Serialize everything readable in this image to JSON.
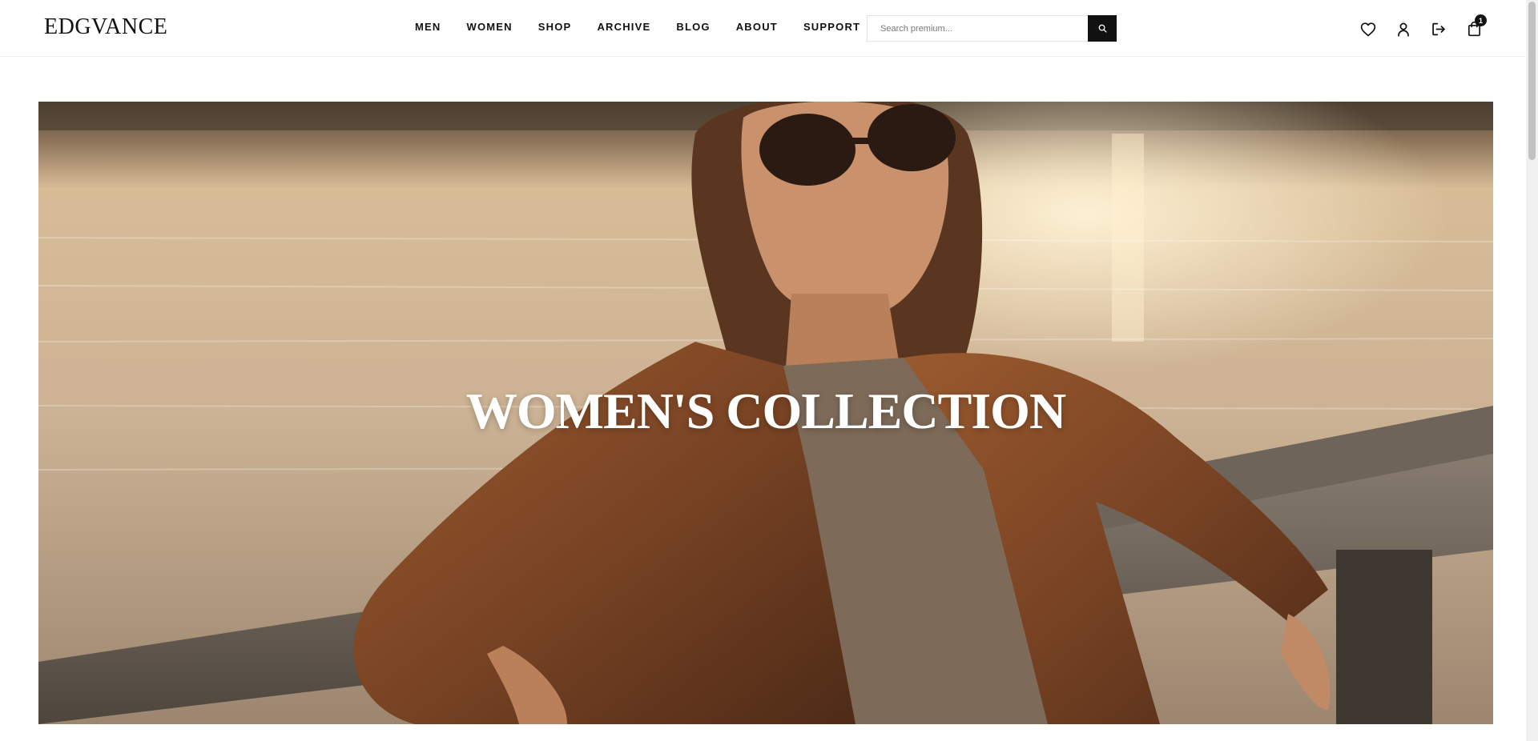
{
  "brand": {
    "logo": "EDGVANCE"
  },
  "nav": {
    "items": [
      {
        "label": "MEN"
      },
      {
        "label": "WOMEN"
      },
      {
        "label": "SHOP"
      },
      {
        "label": "ARCHIVE"
      },
      {
        "label": "BLOG"
      },
      {
        "label": "ABOUT"
      },
      {
        "label": "SUPPORT"
      }
    ]
  },
  "search": {
    "placeholder": "Search premium..."
  },
  "header_icons": {
    "wishlist": "heart-icon",
    "account": "user-icon",
    "logout": "logout-icon",
    "cart": "shopping-bag-icon",
    "cart_count": "1"
  },
  "hero": {
    "title": "WOMEN'S COLLECTION",
    "image": "woman in sunglasses and brown leather jacket on wooden bench by lake at sunset"
  },
  "colors": {
    "primary": "#111111",
    "background": "#ffffff",
    "hero_text": "#ffffff"
  }
}
